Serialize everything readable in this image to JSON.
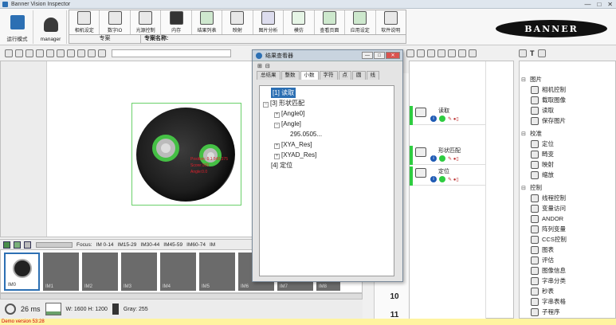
{
  "window": {
    "title": "Banner Vision Inspector",
    "controls": [
      "—",
      "□",
      "✕"
    ]
  },
  "ribbon": {
    "modes": [
      {
        "label": "运行模式",
        "icon": "run-mode-icon"
      },
      {
        "label": "manager",
        "icon": "user-icon"
      }
    ],
    "tools": [
      {
        "label": "相机设定",
        "icon": "camera-settings-icon"
      },
      {
        "label": "数字IO",
        "icon": "digital-io-icon"
      },
      {
        "label": "光源控制",
        "icon": "light-control-icon"
      },
      {
        "label": "内存",
        "icon": "memory-icon"
      },
      {
        "label": "结果列表",
        "icon": "results-list-icon"
      },
      {
        "label": "映射",
        "icon": "mapping-icon"
      },
      {
        "label": "图片分析",
        "icon": "image-analysis-icon"
      },
      {
        "label": "模仿",
        "icon": "emulate-icon"
      },
      {
        "label": "查看页面",
        "icon": "view-page-icon"
      },
      {
        "label": "应用设定",
        "icon": "app-settings-icon"
      },
      {
        "label": "软件说明",
        "icon": "help-icon"
      }
    ],
    "project_label": "专案",
    "project_name_label": "专案名称:",
    "logo": "BANNER"
  },
  "film": {
    "focus": "Focus:",
    "ranges": [
      "IM 0-14",
      "IM15-29",
      "IM30-44",
      "IM45-59",
      "IM60-74",
      "IM"
    ],
    "thumbs": [
      "IM0",
      "IM1",
      "IM2",
      "IM3",
      "IM4",
      "IM5",
      "IM6",
      "IM7",
      "IM8"
    ]
  },
  "status": {
    "time": "26 ms",
    "size": "W: 1600  H: 1200",
    "gray": "Gray: 255"
  },
  "demo": "Demo version  53:28",
  "annotations": [
    "Position: 0 1 540,375",
    "Score:100",
    "Angle:0.0"
  ],
  "dialog": {
    "title": "结果查看器",
    "tabs": [
      "总结果",
      "整数",
      "小数",
      "字符",
      "点",
      "圆",
      "线"
    ],
    "active_tab": 2,
    "tree": [
      {
        "text": "[1] 读取",
        "level": 0,
        "selected": true
      },
      {
        "text": "[3] 形状匹配",
        "level": 0,
        "expander": "−"
      },
      {
        "text": "[Angle0]",
        "level": 1,
        "expander": "+"
      },
      {
        "text": "[Angle]",
        "level": 1,
        "expander": "−"
      },
      {
        "text": "295.0505...",
        "level": 2
      },
      {
        "text": "[XYA_Res]",
        "level": 1,
        "expander": "+"
      },
      {
        "text": "[XYAD_Res]",
        "level": 1,
        "expander": "+"
      },
      {
        "text": "[4] 定位",
        "level": 0
      }
    ]
  },
  "chain": {
    "steps": [
      {
        "label": "读取"
      },
      {
        "label": "形状匹配"
      },
      {
        "label": "定位"
      }
    ],
    "row_numbers": [
      "9",
      "10",
      "11"
    ]
  },
  "library": {
    "items": [
      {
        "label": "图片",
        "group": true
      },
      {
        "label": "相机控制"
      },
      {
        "label": "载取图像"
      },
      {
        "label": "读取"
      },
      {
        "label": "保存图片"
      },
      {
        "label": "校准",
        "group": true
      },
      {
        "label": "定位"
      },
      {
        "label": "畸变"
      },
      {
        "label": "映射"
      },
      {
        "label": "缩放"
      },
      {
        "label": "控制",
        "group": true
      },
      {
        "label": "线程控制"
      },
      {
        "label": "变量访问"
      },
      {
        "label": "ANDOR"
      },
      {
        "label": "阵列变量"
      },
      {
        "label": "CCS控制"
      },
      {
        "label": "图表"
      },
      {
        "label": "评估"
      },
      {
        "label": "图像信息"
      },
      {
        "label": "字串分类"
      },
      {
        "label": "秒表"
      },
      {
        "label": "字串表格"
      },
      {
        "label": "子程序"
      }
    ]
  },
  "colors": {
    "accent": "#2c6fb3",
    "ok": "#2ecc40",
    "roi": "#6ad06a"
  }
}
